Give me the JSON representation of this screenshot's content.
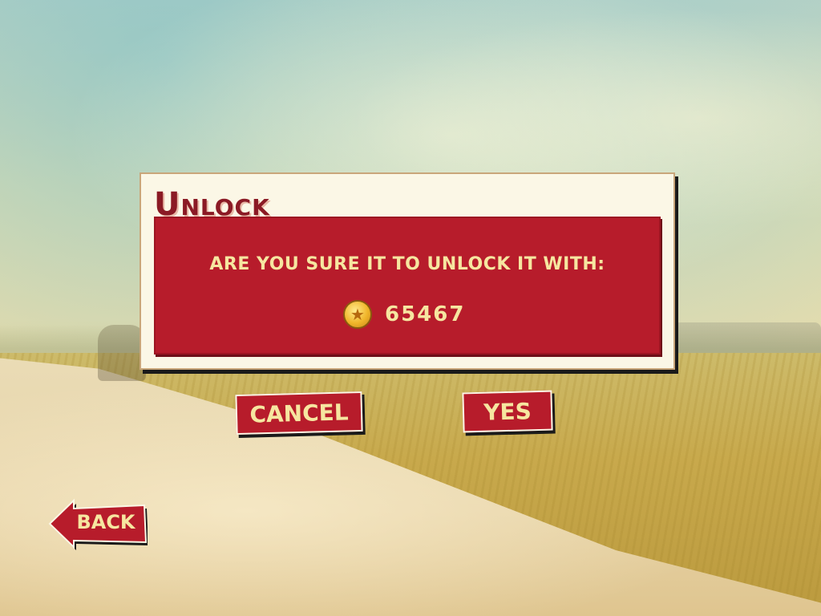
{
  "dialog": {
    "title": "Unlock",
    "question": "ARE YOU SURE IT TO UNLOCK IT WITH:",
    "price": "65467",
    "currency_icon": "gold-star-coin"
  },
  "buttons": {
    "cancel": "CANCEL",
    "yes": "YES",
    "back": "BACK"
  },
  "colors": {
    "panel_red": "#b71c2b",
    "title_red": "#8b1a25",
    "text_yellow": "#f6e6a0",
    "panel_cream": "#fbf7e6"
  }
}
